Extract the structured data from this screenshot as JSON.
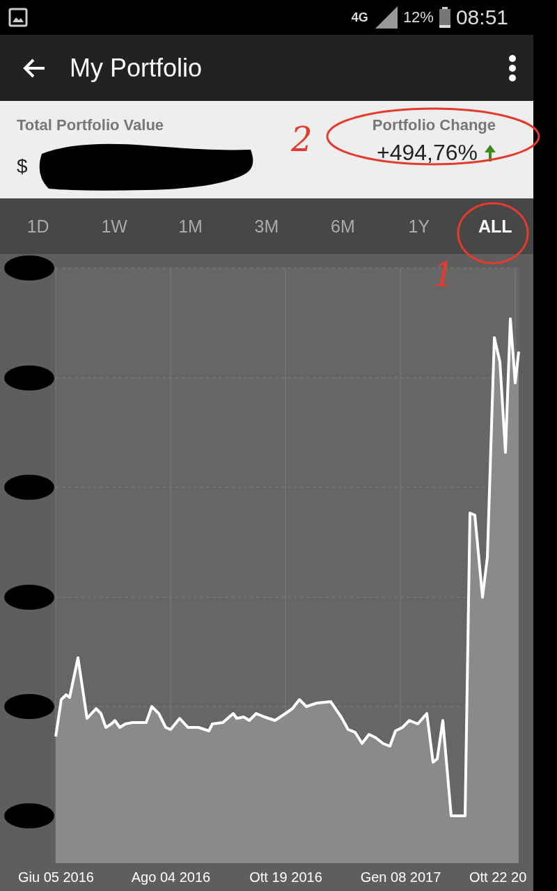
{
  "status_bar": {
    "network": "4G",
    "battery": "12%",
    "time": "08:51"
  },
  "toolbar": {
    "title": "My Portfolio"
  },
  "summary": {
    "value_label": "Total Portfolio Value",
    "currency": "$",
    "change_label": "Portfolio Change",
    "change": "+494,76%"
  },
  "range_tabs": [
    {
      "label": "1D",
      "selected": false
    },
    {
      "label": "1W",
      "selected": false
    },
    {
      "label": "1M",
      "selected": false
    },
    {
      "label": "3M",
      "selected": false
    },
    {
      "label": "6M",
      "selected": false
    },
    {
      "label": "1Y",
      "selected": false
    },
    {
      "label": "ALL",
      "selected": true
    }
  ],
  "chart": {
    "x_labels": [
      "Giu 05 2016",
      "Ago 04 2016",
      "Ott 19 2016",
      "Gen 08 2017",
      "Ott 22 20"
    ]
  },
  "annotations": [
    {
      "label": "2"
    },
    {
      "label": "1"
    }
  ]
}
